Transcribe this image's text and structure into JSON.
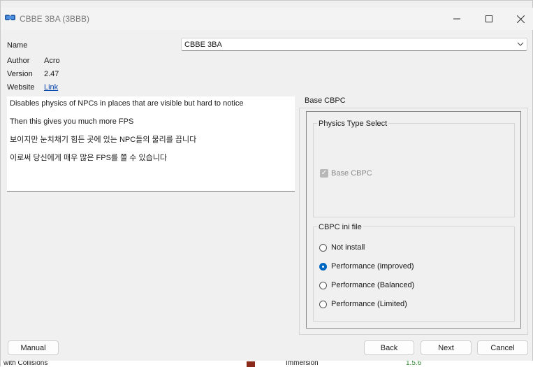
{
  "window": {
    "title": "CBBE 3BA (3BBB)"
  },
  "info": {
    "name_label": "Name",
    "name_value": "CBBE 3BA",
    "author_label": "Author",
    "author_value": "Acro",
    "version_label": "Version",
    "version_value": "2.47",
    "website_label": "Website",
    "website_link": "Link"
  },
  "description": [
    "Disables physics of NPCs in places that are visible but hard to notice",
    "Then this gives you much more FPS",
    "보이지만 눈치채기 힘든 곳에 있는 NPC들의 물리를 끕니다",
    "이로써 당신에게 매우 많은 FPS를 쫄 수 있습니다"
  ],
  "base_group": {
    "title": "Base CBPC",
    "physics_type": {
      "title": "Physics Type Select",
      "checkbox_label": "Base CBPC",
      "checked": true,
      "disabled": true
    },
    "ini_file": {
      "title": "CBPC ini file",
      "options": [
        {
          "label": "Not install",
          "selected": false
        },
        {
          "label": "Performance (improved)",
          "selected": true
        },
        {
          "label": "Performance (Balanced)",
          "selected": false
        },
        {
          "label": "Performance (Limited)",
          "selected": false
        }
      ]
    }
  },
  "buttons": {
    "manual": "Manual",
    "back": "Back",
    "next": "Next",
    "cancel": "Cancel"
  },
  "background_strip": {
    "col1": "with Collisions",
    "col2": "Immersion",
    "col3": "1.5.6"
  },
  "colors": {
    "accent": "#0067c0",
    "link": "#0645ad"
  }
}
